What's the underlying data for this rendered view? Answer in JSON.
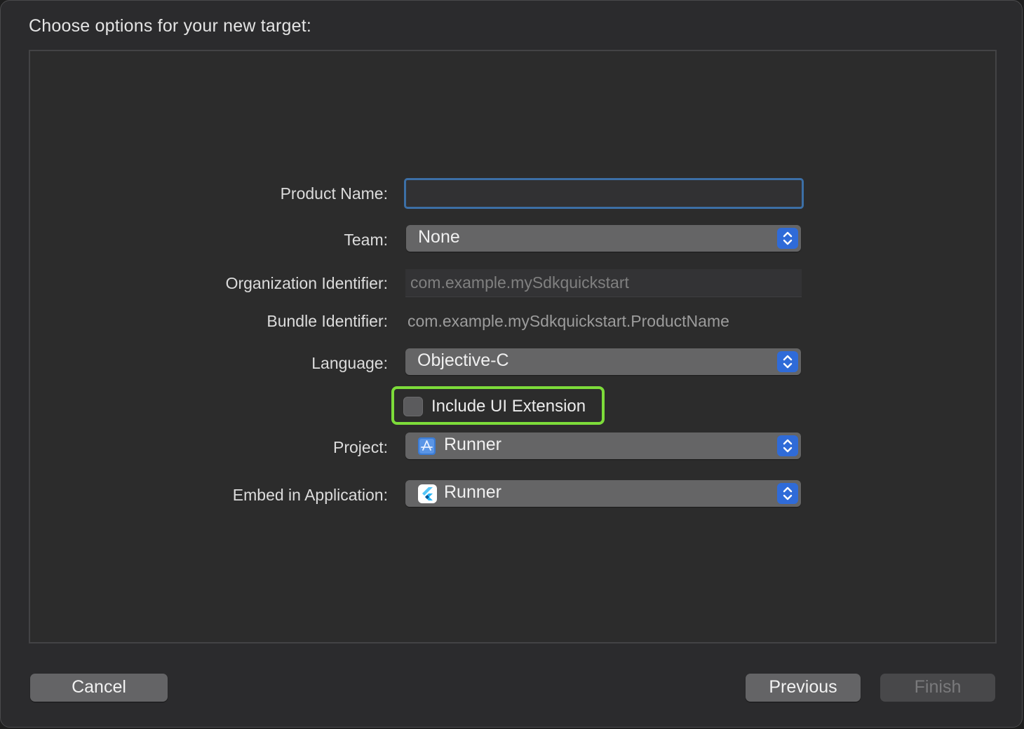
{
  "dialog": {
    "title": "Choose options for your new target:"
  },
  "form": {
    "product_name": {
      "label": "Product Name:",
      "value": "",
      "placeholder": ""
    },
    "team": {
      "label": "Team:",
      "value": "None"
    },
    "organization_identifier": {
      "label": "Organization Identifier:",
      "placeholder": "com.example.mySdkquickstart"
    },
    "bundle_identifier": {
      "label": "Bundle Identifier:",
      "value": "com.example.mySdkquickstart.ProductName"
    },
    "language": {
      "label": "Language:",
      "value": "Objective-C"
    },
    "include_ui_extension": {
      "label": "Include UI Extension",
      "checked": false
    },
    "project": {
      "label": "Project:",
      "value": "Runner",
      "icon": "xcode-project-icon"
    },
    "embed_in_application": {
      "label": "Embed in Application:",
      "value": "Runner",
      "icon": "flutter-app-icon"
    }
  },
  "buttons": {
    "cancel": "Cancel",
    "previous": "Previous",
    "finish": "Finish"
  },
  "colors": {
    "focus_ring": "#3c6fa6",
    "stepper_blue": "#2f6bd8",
    "highlight_green": "#7ddc3a"
  }
}
